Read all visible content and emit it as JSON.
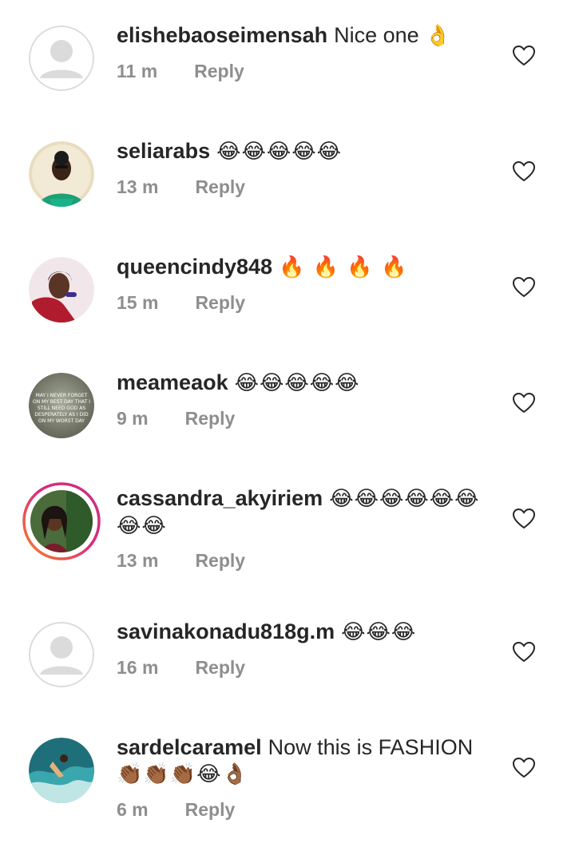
{
  "comments": [
    {
      "username": "elishebaoseimensah",
      "text": "Nice one",
      "emoji": "👌",
      "time": "11 m",
      "reply": "Reply"
    },
    {
      "username": "seliarabs",
      "text": "",
      "emoji": "😂😂😂😂😂",
      "time": "13 m",
      "reply": "Reply"
    },
    {
      "username": "queencindy848",
      "text": "",
      "emoji": "🔥 🔥 🔥 🔥",
      "time": "15 m",
      "reply": "Reply"
    },
    {
      "username": "meameaok",
      "text": "",
      "emoji": "😂😂😂😂😂",
      "time": "9 m",
      "reply": "Reply",
      "avatar_text": [
        "MAY I NEVER FORGET",
        "ON MY BEST DAY THAT I",
        "STILL NEED GOD AS",
        "DESPERATELY AS I DID",
        "ON MY WORST DAY"
      ]
    },
    {
      "username": "cassandra_akyiriem",
      "text": "",
      "emoji": "😂😂😂😂😂😂",
      "emoji2": "😂😂",
      "time": "13 m",
      "reply": "Reply"
    },
    {
      "username": "savinakonadu818g.m",
      "text": "",
      "emoji": "😂😂😂",
      "time": "16 m",
      "reply": "Reply"
    },
    {
      "username": "sardelcaramel",
      "text": "Now this is FASHION",
      "emoji2": "👏🏾👏🏾👏🏾😂👌🏾",
      "time": "6 m",
      "reply": "Reply"
    }
  ],
  "colors": {
    "text": "#262626",
    "meta": "#8e8e8e",
    "heart": "#262626",
    "placeholder_bg": "#dbdbdb",
    "story_ring_start": "#f58529",
    "story_ring_end": "#dd2a7b"
  },
  "icons": {
    "like": "heart-outline-icon",
    "placeholder": "default-avatar-icon"
  }
}
